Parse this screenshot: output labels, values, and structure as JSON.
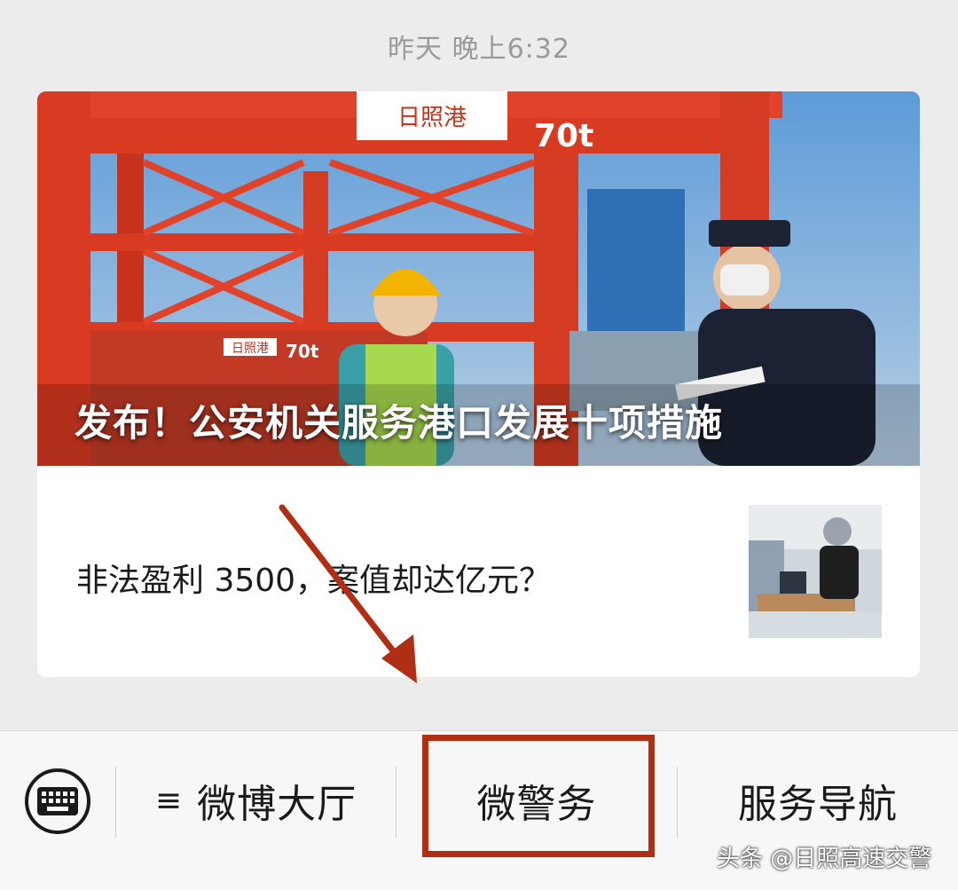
{
  "timestamp": "昨天 晚上6:32",
  "card": {
    "hero_title": "发布！公安机关服务港口发展十项措施",
    "hero_signage": {
      "logo_text": "日照港",
      "capacity": "70t",
      "capacity_small": "70t",
      "logo_small": "日照港"
    },
    "article_title": "非法盈利 3500，案值却达亿元？"
  },
  "bottom_menu": {
    "keyboard_icon": "keyboard-icon",
    "items": [
      {
        "label": "微博大厅",
        "icon": "hamburger-icon",
        "glyph": "≡"
      },
      {
        "label": "微警务"
      },
      {
        "label": "服务导航"
      }
    ]
  },
  "annotation": {
    "color": "#b02f14"
  },
  "watermark": "头条 @日照高速交警"
}
